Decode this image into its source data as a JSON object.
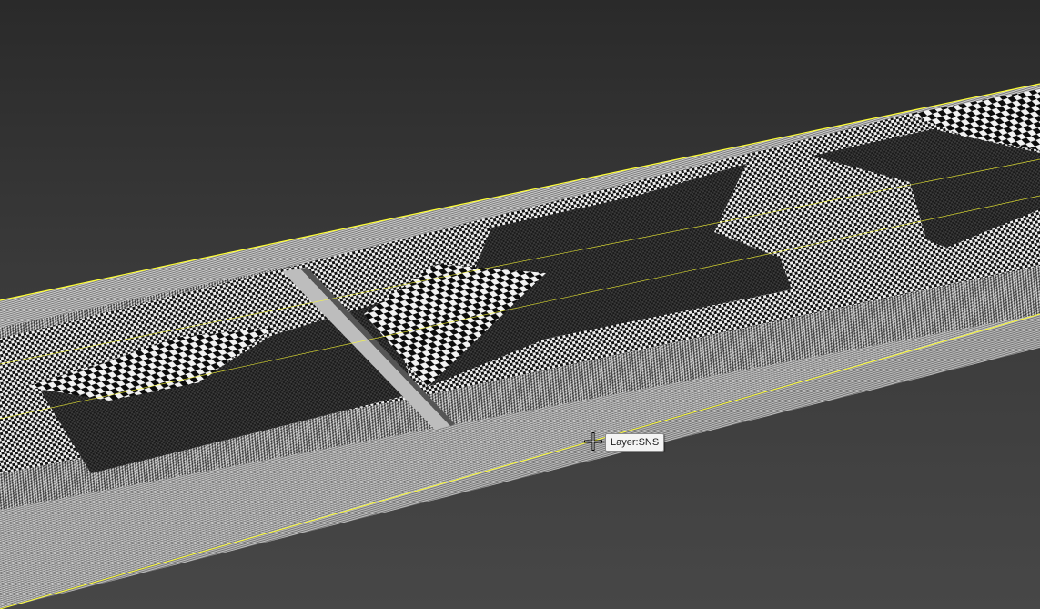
{
  "viewport": {
    "tooltip_text": "Layer:SNS",
    "cursor_icon": "move-crosshair-icon",
    "colors": {
      "background_top": "#2a2a2a",
      "background_bottom": "#474747",
      "edge_highlight": "#ffff33",
      "checker_dark": "#111111",
      "checker_light": "#f0f0f0"
    }
  }
}
